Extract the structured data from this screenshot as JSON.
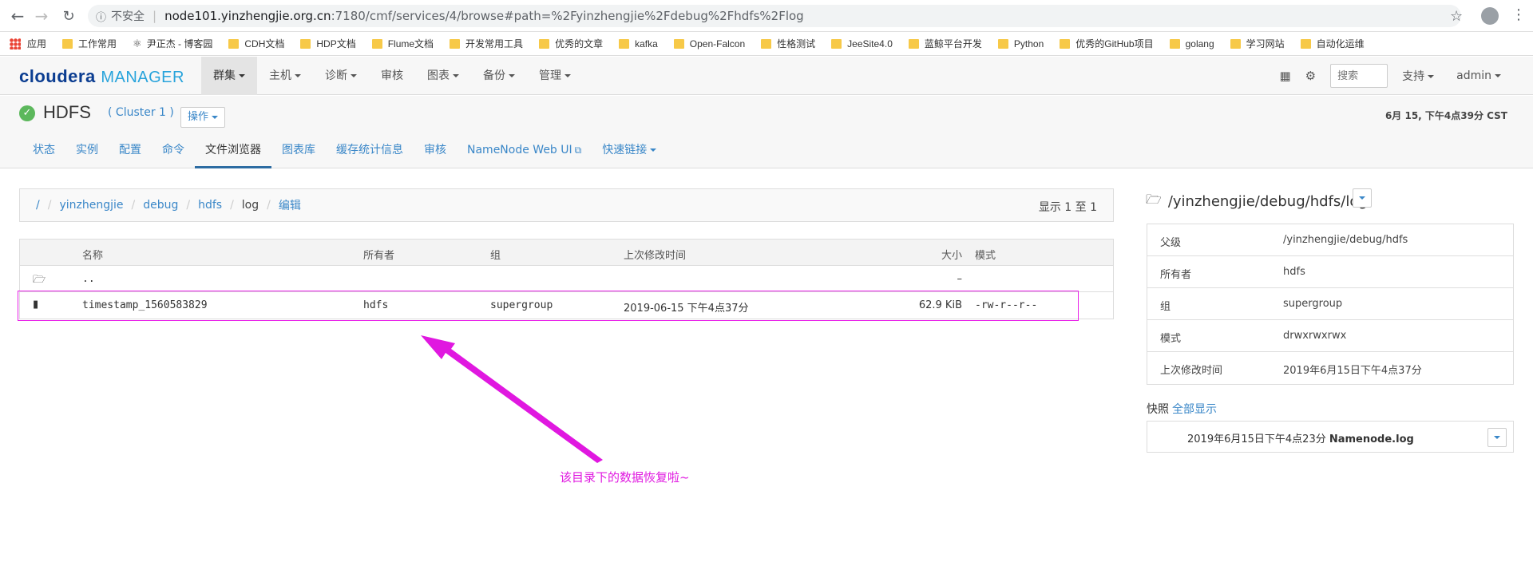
{
  "browser": {
    "insecure_label": "不安全",
    "url_host": "node101.yinzhengjie.org.cn",
    "url_path": ":7180/cmf/services/4/browse#path=%2Fyinzhengjie%2Fdebug%2Fhdfs%2Flog",
    "bookmarks": [
      {
        "label": "应用",
        "icon": "apps-icon"
      },
      {
        "label": "工作常用",
        "icon": "folder-icon"
      },
      {
        "label": "尹正杰 - 博客园",
        "icon": "blog-icon"
      },
      {
        "label": "CDH文档",
        "icon": "folder-icon"
      },
      {
        "label": "HDP文档",
        "icon": "folder-icon"
      },
      {
        "label": "Flume文档",
        "icon": "folder-icon"
      },
      {
        "label": "开发常用工具",
        "icon": "folder-icon"
      },
      {
        "label": "优秀的文章",
        "icon": "folder-icon"
      },
      {
        "label": "kafka",
        "icon": "folder-icon"
      },
      {
        "label": "Open-Falcon",
        "icon": "folder-icon"
      },
      {
        "label": "性格测试",
        "icon": "folder-icon"
      },
      {
        "label": "JeeSite4.0",
        "icon": "folder-icon"
      },
      {
        "label": "蓝鲸平台开发",
        "icon": "folder-icon"
      },
      {
        "label": "Python",
        "icon": "folder-icon"
      },
      {
        "label": "优秀的GitHub项目",
        "icon": "folder-icon"
      },
      {
        "label": "golang",
        "icon": "folder-icon"
      },
      {
        "label": "学习网站",
        "icon": "folder-icon"
      },
      {
        "label": "自动化运维",
        "icon": "folder-icon"
      }
    ]
  },
  "header": {
    "logo_part1": "cloudera",
    "logo_part2": "MANAGER",
    "nav": [
      {
        "label": "群集",
        "dropdown": true,
        "active": true
      },
      {
        "label": "主机",
        "dropdown": true
      },
      {
        "label": "诊断",
        "dropdown": true
      },
      {
        "label": "审核",
        "dropdown": false
      },
      {
        "label": "图表",
        "dropdown": true
      },
      {
        "label": "备份",
        "dropdown": true
      },
      {
        "label": "管理",
        "dropdown": true
      }
    ],
    "search_placeholder": "搜索",
    "support_label": "支持",
    "user_label": "admin"
  },
  "service": {
    "name": "HDFS",
    "cluster": "( Cluster 1 )",
    "actions_label": "操作",
    "datetime": "6月 15, 下午4点39分 CST",
    "tabs": [
      {
        "label": "状态"
      },
      {
        "label": "实例"
      },
      {
        "label": "配置"
      },
      {
        "label": "命令"
      },
      {
        "label": "文件浏览器",
        "active": true
      },
      {
        "label": "图表库"
      },
      {
        "label": "缓存统计信息"
      },
      {
        "label": "审核"
      },
      {
        "label": "NameNode Web UI",
        "external": true
      },
      {
        "label": "快速链接",
        "dropdown": true
      }
    ]
  },
  "breadcrumb": {
    "items": [
      "/",
      "yinzhengjie",
      "debug",
      "hdfs"
    ],
    "current": "log",
    "edit_label": "编辑",
    "showing": "显示 1 至 1"
  },
  "file_table": {
    "headers": {
      "name": "名称",
      "owner": "所有者",
      "group": "组",
      "modified": "上次修改时间",
      "size": "大小",
      "mode": "模式"
    },
    "rows": [
      {
        "icon": "folder-open-icon",
        "name": "..",
        "owner": "",
        "group": "",
        "modified": "",
        "size": "–",
        "mode": ""
      },
      {
        "icon": "file-icon",
        "name": "timestamp_1560583829",
        "owner": "hdfs",
        "group": "supergroup",
        "modified": "2019-06-15 下午4点37分",
        "size": "62.9 KiB",
        "mode": "-rw-r--r--"
      }
    ]
  },
  "annotation": {
    "text": "该目录下的数据恢复啦~",
    "color": "#e018e0"
  },
  "details": {
    "path": "/yinzhengjie/debug/hdfs/log",
    "rows": [
      {
        "key": "父级",
        "value": "/yinzhengjie/debug/hdfs"
      },
      {
        "key": "所有者",
        "value": "hdfs"
      },
      {
        "key": "组",
        "value": "supergroup"
      },
      {
        "key": "模式",
        "value": "drwxrwxrwx"
      },
      {
        "key": "上次修改时间",
        "value": "2019年6月15日下午4点37分"
      }
    ],
    "snapshot_label": "快照",
    "snapshot_show_all": "全部显示",
    "snapshot_time": "2019年6月15日下午4点23分",
    "snapshot_name": "Namenode.log"
  }
}
